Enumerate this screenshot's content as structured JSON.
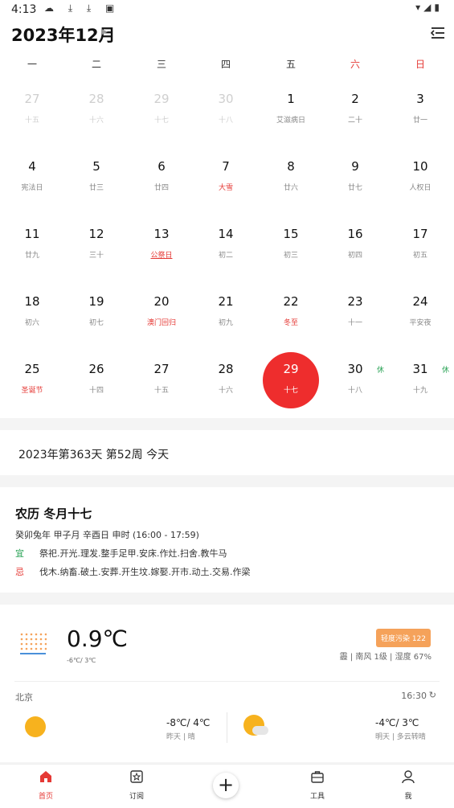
{
  "status_bar": {
    "time": "4:13",
    "left_icons": "☁ ⤓ ⤓ ▣",
    "right_icons": "▾◢▮"
  },
  "header": {
    "month_title": "2023年12月"
  },
  "calendar": {
    "weekdays": [
      "一",
      "二",
      "三",
      "四",
      "五",
      "六",
      "日"
    ],
    "days": [
      {
        "d": "27",
        "s": "十五",
        "dim": true
      },
      {
        "d": "28",
        "s": "十六",
        "dim": true
      },
      {
        "d": "29",
        "s": "十七",
        "dim": true
      },
      {
        "d": "30",
        "s": "十八",
        "dim": true
      },
      {
        "d": "1",
        "s": "艾滋病日"
      },
      {
        "d": "2",
        "s": "二十"
      },
      {
        "d": "3",
        "s": "廿一"
      },
      {
        "d": "4",
        "s": "宪法日"
      },
      {
        "d": "5",
        "s": "廿三"
      },
      {
        "d": "6",
        "s": "廿四"
      },
      {
        "d": "7",
        "s": "大雪",
        "red": true
      },
      {
        "d": "8",
        "s": "廿六"
      },
      {
        "d": "9",
        "s": "廿七"
      },
      {
        "d": "10",
        "s": "人权日"
      },
      {
        "d": "11",
        "s": "廿九"
      },
      {
        "d": "12",
        "s": "三十"
      },
      {
        "d": "13",
        "s": "公祭日",
        "red": true,
        "ul": true
      },
      {
        "d": "14",
        "s": "初二"
      },
      {
        "d": "15",
        "s": "初三"
      },
      {
        "d": "16",
        "s": "初四"
      },
      {
        "d": "17",
        "s": "初五"
      },
      {
        "d": "18",
        "s": "初六"
      },
      {
        "d": "19",
        "s": "初七"
      },
      {
        "d": "20",
        "s": "澳门回归",
        "red": true
      },
      {
        "d": "21",
        "s": "初九"
      },
      {
        "d": "22",
        "s": "冬至",
        "red": true
      },
      {
        "d": "23",
        "s": "十一"
      },
      {
        "d": "24",
        "s": "平安夜"
      },
      {
        "d": "25",
        "s": "圣诞节",
        "red": true
      },
      {
        "d": "26",
        "s": "十四"
      },
      {
        "d": "27",
        "s": "十五"
      },
      {
        "d": "28",
        "s": "十六"
      },
      {
        "d": "29",
        "s": "十七",
        "today": true
      },
      {
        "d": "30",
        "s": "十八",
        "rest": "休"
      },
      {
        "d": "31",
        "s": "十九",
        "rest": "休"
      }
    ]
  },
  "days_info": "2023年第363天 第52周 今天",
  "lunar": {
    "title": "农历 冬月十七",
    "ganzhi": "癸卯兔年 甲子月 辛酉日 申时 (16:00 - 17:59)",
    "yi_label": "宜",
    "yi": "祭祀.开光.理发.整手足甲.安床.作灶.扫舍.教牛马",
    "ji_label": "忌",
    "ji": "伐木.纳畜.破土.安葬.开生坟.嫁娶.开市.动土.交易.作梁"
  },
  "weather": {
    "temp": "0.9℃",
    "range": "-6℃/ 3℃",
    "aqi": "轻度污染 122",
    "detail": "霾 | 南风 1级 | 湿度 67%",
    "city": "北京",
    "updated": "16:30",
    "yesterday_temp": "-8℃/ 4℃",
    "yesterday_desc": "昨天 | 晴",
    "tomorrow_temp": "-4℃/ 3℃",
    "tomorrow_desc": "明天 | 多云转晴"
  },
  "nav": {
    "home": "首页",
    "subscribe": "订阅",
    "tools": "工具",
    "me": "我"
  },
  "colors": {
    "accent": "#ee2d2d",
    "green": "#2aa356",
    "aqi": "#f5a25a"
  }
}
